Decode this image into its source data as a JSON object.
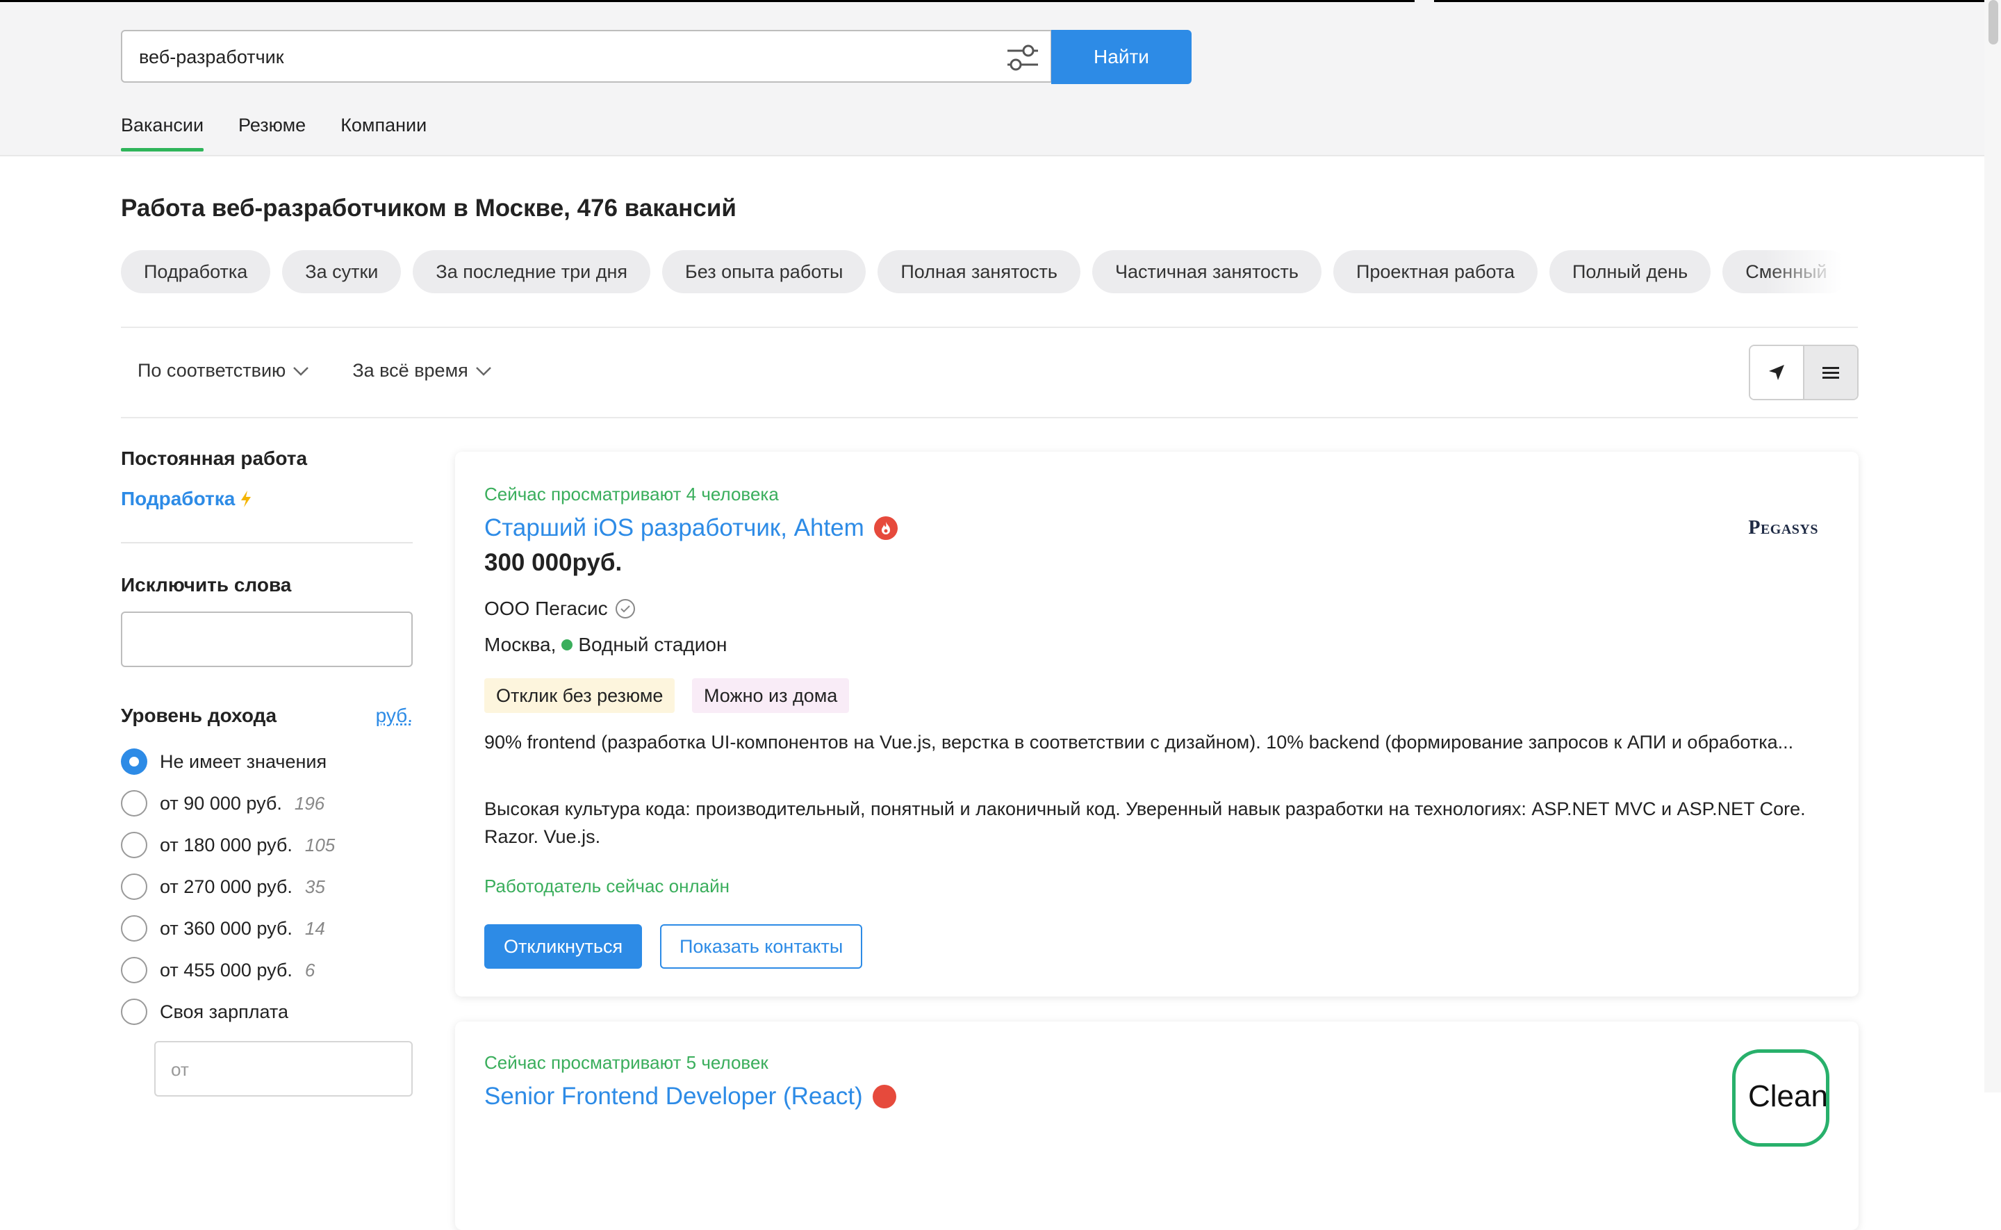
{
  "search": {
    "query": "веб-разработчик",
    "button_label": "Найти"
  },
  "tabs": [
    {
      "label": "Вакансии",
      "active": true
    },
    {
      "label": "Резюме",
      "active": false
    },
    {
      "label": "Компании",
      "active": false
    }
  ],
  "page_title": "Работа веб-разработчиком в Москве, 476 вакансий",
  "chips": [
    "Подработка",
    "За сутки",
    "За последние три дня",
    "Без опыта работы",
    "Полная занятость",
    "Частичная занятость",
    "Проектная работа",
    "Полный день",
    "Сменный"
  ],
  "sort": {
    "relevance": "По соответствию",
    "period": "За всё время"
  },
  "view_toggle": {
    "map_icon": "navigation-arrow-icon",
    "list_icon": "list-icon",
    "active": "list"
  },
  "sidebar": {
    "permanent_heading": "Постоянная работа",
    "part_time_link": "Подработка",
    "exclude_heading": "Исключить слова",
    "income_heading": "Уровень дохода",
    "currency_link": "руб.",
    "income_options": [
      {
        "label": "Не имеет значения",
        "count": "",
        "checked": true
      },
      {
        "label": "от 90 000 руб.",
        "count": "196",
        "checked": false
      },
      {
        "label": "от 180 000 руб.",
        "count": "105",
        "checked": false
      },
      {
        "label": "от 270 000 руб.",
        "count": "35",
        "checked": false
      },
      {
        "label": "от 360 000 руб.",
        "count": "14",
        "checked": false
      },
      {
        "label": "от 455 000 руб.",
        "count": "6",
        "checked": false
      },
      {
        "label": "Своя зарплата",
        "count": "",
        "checked": false
      }
    ],
    "salary_placeholder": "от"
  },
  "vacancies": [
    {
      "viewers": "Сейчас просматривают 4 человека",
      "title": "Старший iOS разработчик, Ahtem",
      "salary": "300 000руб.",
      "company": "ООО Пегасис",
      "city": "Москва,",
      "metro": "Водный стадион",
      "tags": [
        "Отклик без резюме",
        "Можно из дома"
      ],
      "description_1": "90% frontend (разработка UI-компонентов на Vue.js, верстка в соответствии с дизайном). 10% backend (формирование запросов к АПИ и обработка...",
      "description_2": "Высокая культура кода: производительный, понятный и лаконичный код. Уверенный навык разработки на технологиях: ASP.NET MVC и ASP.NET Core. Razor. Vue.js.",
      "employer_status": "Работодатель сейчас онлайн",
      "apply_label": "Откликнуться",
      "contacts_label": "Показать контакты",
      "logo_text": "Pegasys"
    },
    {
      "viewers": "Сейчас просматривают 5 человек",
      "title": "Senior Frontend Developer (React)",
      "logo_text": "Clean"
    }
  ],
  "colors": {
    "accent": "#2d8be6",
    "green": "#3aae5c",
    "hot": "#e64a3c"
  }
}
